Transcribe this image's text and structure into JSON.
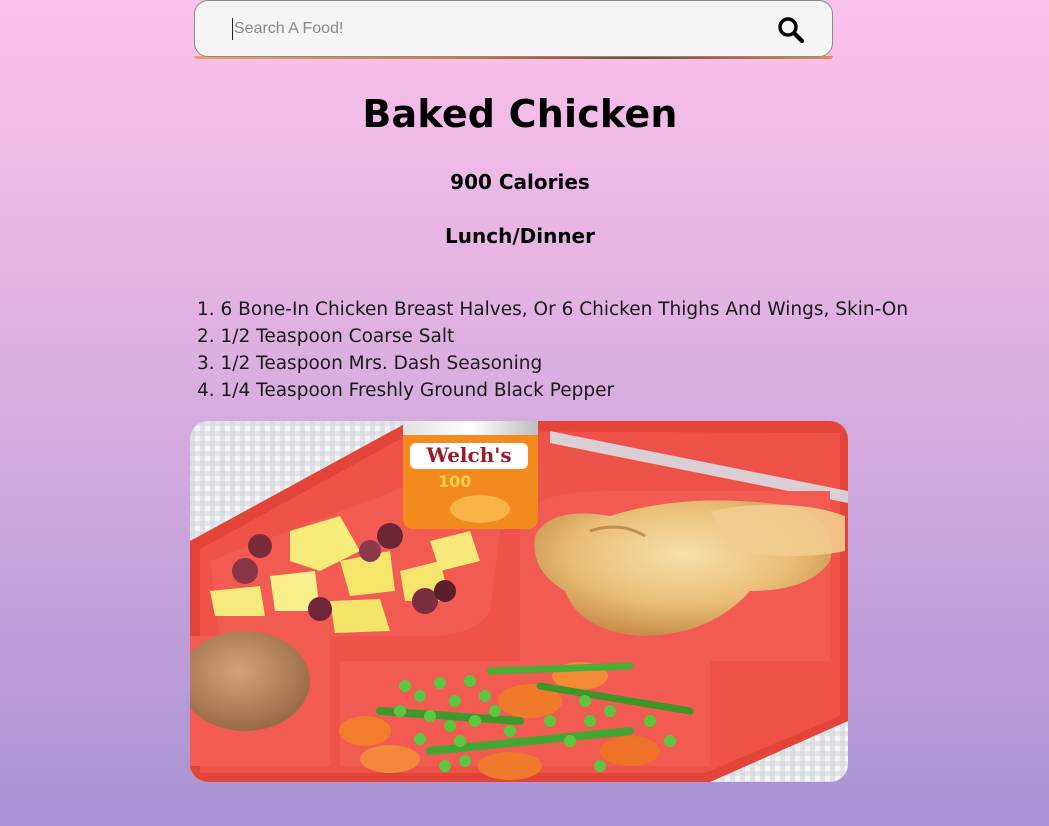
{
  "search": {
    "placeholder": "Search A Food!",
    "value": "",
    "icon": "search-icon"
  },
  "food": {
    "name": "Baked Chicken",
    "calories": "900 Calories",
    "meal_type": "Lunch/Dinner",
    "ingredients": [
      "1. 6 Bone-In Chicken Breast Halves, Or 6 Chicken Thighs And Wings, Skin-On",
      "2. 1/2 Teaspoon Coarse Salt",
      "3. 1/2 Teaspoon Mrs. Dash Seasoning",
      "4. 1/4 Teaspoon Freshly Ground Black Pepper"
    ],
    "image": {
      "can_label": "Welch's",
      "can_sublabel": "100"
    }
  }
}
